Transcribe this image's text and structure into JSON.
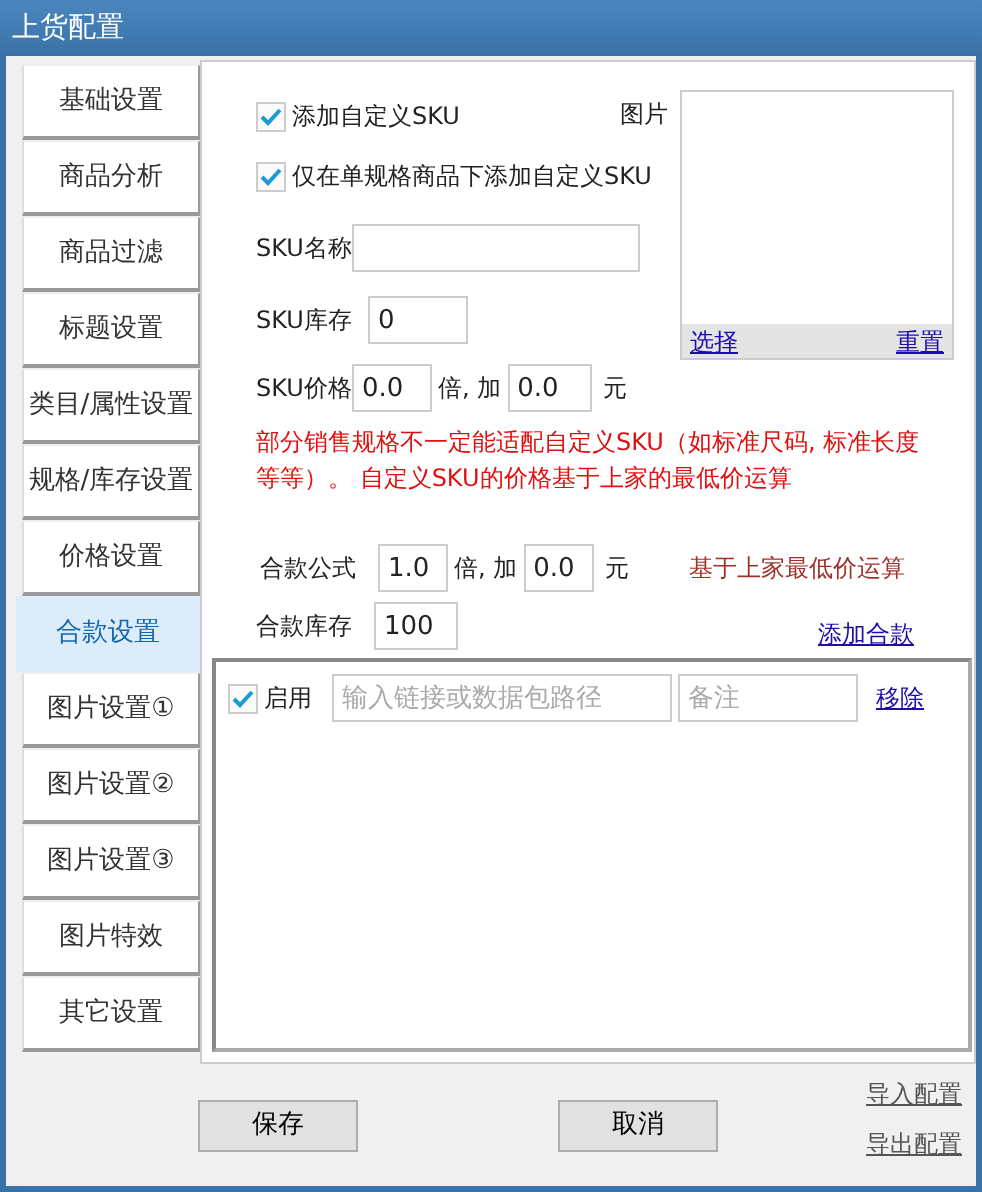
{
  "window": {
    "title": "上货配置"
  },
  "sidebar": {
    "tabs": [
      {
        "label": "基础设置",
        "selected": false
      },
      {
        "label": "商品分析",
        "selected": false
      },
      {
        "label": "商品过滤",
        "selected": false
      },
      {
        "label": "标题设置",
        "selected": false
      },
      {
        "label": "类目/属性设置",
        "selected": false
      },
      {
        "label": "规格/库存设置",
        "selected": false
      },
      {
        "label": "价格设置",
        "selected": false
      },
      {
        "label": "合款设置",
        "selected": true
      },
      {
        "label": "图片设置①",
        "selected": false
      },
      {
        "label": "图片设置②",
        "selected": false
      },
      {
        "label": "图片设置③",
        "selected": false
      },
      {
        "label": "图片特效",
        "selected": false
      },
      {
        "label": "其它设置",
        "selected": false
      }
    ]
  },
  "sku": {
    "options": [
      {
        "label": "添加自定义SKU",
        "checked": true
      },
      {
        "label": "仅在单规格商品下添加自定义SKU",
        "checked": true
      }
    ],
    "name": {
      "label": "SKU名称"
    },
    "stock": {
      "label": "SKU库存",
      "value": "0"
    },
    "price": {
      "label": "SKU价格",
      "multiplier": "0.0",
      "times_label": "倍, 加",
      "addend": "0.0",
      "unit": "元"
    },
    "picture": {
      "label": "图片",
      "select_link": "选择",
      "reset_link": "重置"
    },
    "note": "部分销售规格不一定能适配自定义SKU（如标准尺码, 标准长度等等）。 自定义SKU的价格基于上家的最低价运算"
  },
  "combo": {
    "formula": {
      "label": "合款公式",
      "multiplier": "1.0",
      "times_label": "倍, 加",
      "addend": "0.0",
      "unit": "元",
      "hint": "基于上家最低价运算"
    },
    "stock": {
      "label": "合款库存",
      "value": "100"
    },
    "add_link": "添加合款",
    "items": [
      {
        "enabled": true,
        "enabled_label": "启用",
        "path_placeholder": "输入链接或数据包路径",
        "note_placeholder": "备注",
        "remove_link": "移除"
      }
    ]
  },
  "buttons": [
    {
      "label": "保存"
    },
    {
      "label": "取消"
    }
  ],
  "config_links": [
    {
      "label": "导入配置"
    },
    {
      "label": "导出配置"
    }
  ]
}
